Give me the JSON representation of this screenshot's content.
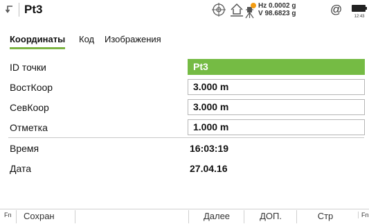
{
  "header": {
    "title": "Pt3",
    "hz_line": "Hz 0.0002 g",
    "v_line": "V  98.6823 g",
    "at_symbol": "@",
    "battery_time": "12:43"
  },
  "tabs": [
    "Координаты",
    "Код",
    "Изображения"
  ],
  "fields": [
    {
      "label": "ID точки",
      "value": "Pt3"
    },
    {
      "label": "ВостКоор",
      "value": "3.000 m"
    },
    {
      "label": "СевКоор",
      "value": "3.000 m"
    },
    {
      "label": "Отметка",
      "value": "1.000 m"
    }
  ],
  "info": [
    {
      "label": "Время",
      "value": "16:03:19"
    },
    {
      "label": "Дата",
      "value": "27.04.16"
    }
  ],
  "softkeys": {
    "fn": "Fn",
    "save": "Сохран",
    "next": "Далее",
    "more": "ДОП.",
    "page": "Стр"
  },
  "colors": {
    "accent": "#75bb44"
  }
}
